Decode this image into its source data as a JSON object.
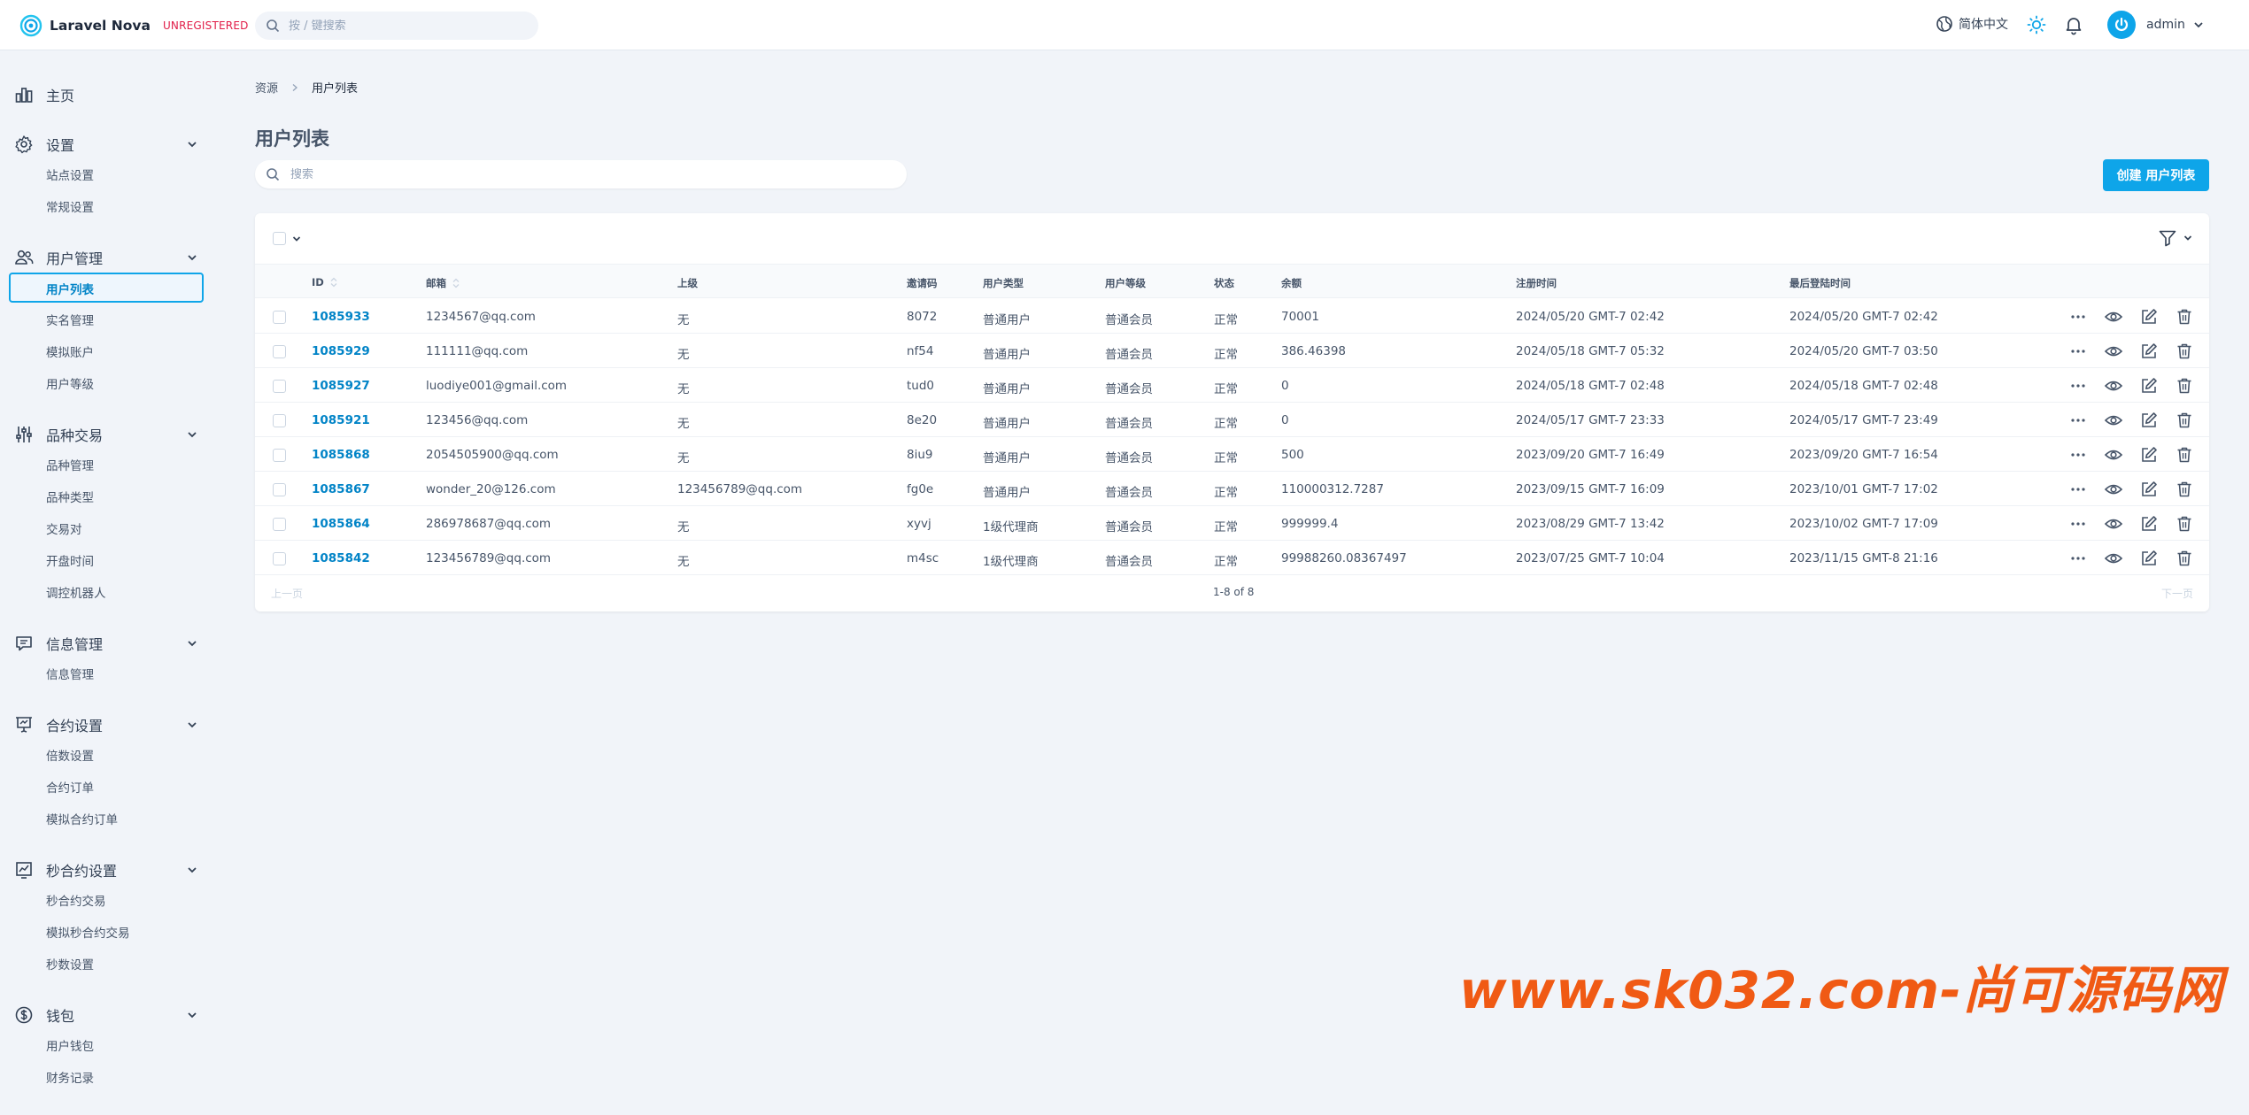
{
  "header": {
    "brand_name": "Laravel Nova",
    "brand_badge": "UNREGISTERED",
    "search_placeholder": "按 / 键搜索",
    "language": "简体中文",
    "user": "admin",
    "accent": "#0ea5e9"
  },
  "sidebar": {
    "groups": [
      {
        "label": "主页",
        "icon": "bar-chart-icon",
        "items": []
      },
      {
        "label": "设置",
        "icon": "gear-icon",
        "items": [
          "站点设置",
          "常规设置"
        ]
      },
      {
        "label": "用户管理",
        "icon": "users-icon",
        "items": [
          "用户列表",
          "实名管理",
          "模拟账户",
          "用户等级"
        ],
        "active": "用户列表"
      },
      {
        "label": "品种交易",
        "icon": "sliders-icon",
        "items": [
          "品种管理",
          "品种类型",
          "交易对",
          "开盘时间",
          "调控机器人"
        ]
      },
      {
        "label": "信息管理",
        "icon": "message-icon",
        "items": [
          "信息管理"
        ]
      },
      {
        "label": "合约设置",
        "icon": "presentation-chart-icon",
        "items": [
          "倍数设置",
          "合约订单",
          "模拟合约订单"
        ]
      },
      {
        "label": "秒合约设置",
        "icon": "trending-chart-icon",
        "items": [
          "秒合约交易",
          "模拟秒合约交易",
          "秒数设置"
        ]
      },
      {
        "label": "钱包",
        "icon": "dollar-circle-icon",
        "items": [
          "用户钱包",
          "财务记录"
        ]
      }
    ]
  },
  "breadcrumb": [
    "资源",
    "用户列表"
  ],
  "page": {
    "title": "用户列表",
    "search_placeholder": "搜索",
    "create_label": "创建 用户列表"
  },
  "table": {
    "columns": [
      "ID",
      "邮箱",
      "上级",
      "邀请码",
      "用户类型",
      "用户等级",
      "状态",
      "余额",
      "注册时间",
      "最后登陆时间"
    ],
    "rows": [
      [
        "1085933",
        "1234567@qq.com",
        "无",
        "8072",
        "普通用户",
        "普通会员",
        "正常",
        "70001",
        "2024/05/20 GMT-7 02:42",
        "2024/05/20 GMT-7 02:42"
      ],
      [
        "1085929",
        "111111@qq.com",
        "无",
        "nf54",
        "普通用户",
        "普通会员",
        "正常",
        "386.46398",
        "2024/05/18 GMT-7 05:32",
        "2024/05/20 GMT-7 03:50"
      ],
      [
        "1085927",
        "luodiye001@gmail.com",
        "无",
        "tud0",
        "普通用户",
        "普通会员",
        "正常",
        "0",
        "2024/05/18 GMT-7 02:48",
        "2024/05/18 GMT-7 02:48"
      ],
      [
        "1085921",
        "123456@qq.com",
        "无",
        "8e20",
        "普通用户",
        "普通会员",
        "正常",
        "0",
        "2024/05/17 GMT-7 23:33",
        "2024/05/17 GMT-7 23:49"
      ],
      [
        "1085868",
        "2054505900@qq.com",
        "无",
        "8iu9",
        "普通用户",
        "普通会员",
        "正常",
        "500",
        "2023/09/20 GMT-7 16:49",
        "2023/09/20 GMT-7 16:54"
      ],
      [
        "1085867",
        "wonder_20@126.com",
        "123456789@qq.com",
        "fg0e",
        "普通用户",
        "普通会员",
        "正常",
        "110000312.7287",
        "2023/09/15 GMT-7 16:09",
        "2023/10/01 GMT-7 17:02"
      ],
      [
        "1085864",
        "286978687@qq.com",
        "无",
        "xyvj",
        "1级代理商",
        "普通会员",
        "正常",
        "999999.4",
        "2023/08/29 GMT-7 13:42",
        "2023/10/02 GMT-7 17:09"
      ],
      [
        "1085842",
        "123456789@qq.com",
        "无",
        "m4sc",
        "1级代理商",
        "普通会员",
        "正常",
        "99988260.08367497",
        "2023/07/25 GMT-7 10:04",
        "2023/11/15 GMT-8 21:16"
      ]
    ]
  },
  "pagination": {
    "prev": "上一页",
    "info": "1-8 of 8",
    "next": "下一页"
  },
  "watermark": "www.sk032.com-尚可源码网"
}
